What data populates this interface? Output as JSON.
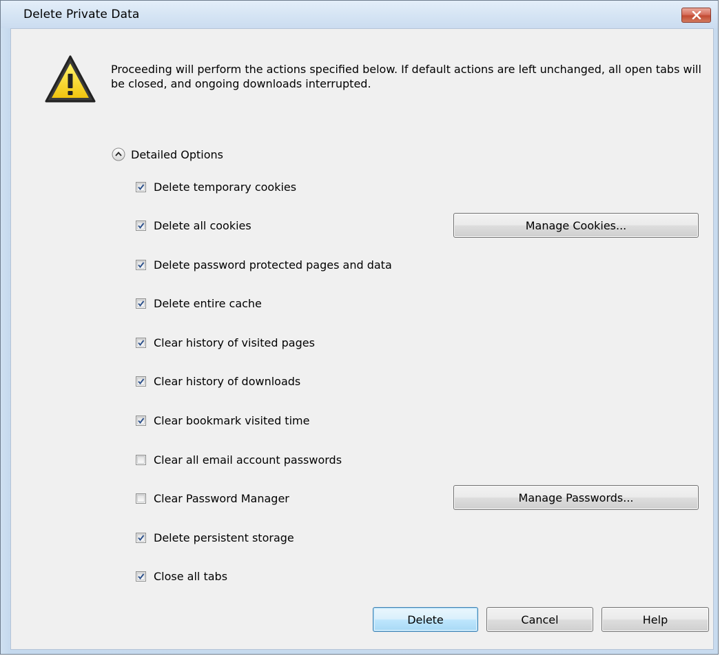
{
  "window": {
    "title": "Delete Private Data"
  },
  "warning": {
    "icon": "warning-icon",
    "message": "Proceeding will perform the actions specified below. If default actions are left unchanged, all open tabs will be closed, and ongoing downloads interrupted."
  },
  "detailed_options": {
    "label": "Detailed Options",
    "expanded": true
  },
  "options": [
    {
      "label": "Delete temporary cookies",
      "checked": true
    },
    {
      "label": "Delete all cookies",
      "checked": true
    },
    {
      "label": "Delete password protected pages and data",
      "checked": true
    },
    {
      "label": "Delete entire cache",
      "checked": true
    },
    {
      "label": "Clear history of visited pages",
      "checked": true
    },
    {
      "label": "Clear history of downloads",
      "checked": true
    },
    {
      "label": "Clear bookmark visited time",
      "checked": true
    },
    {
      "label": "Clear all email account passwords",
      "checked": false
    },
    {
      "label": "Clear Password Manager",
      "checked": false
    },
    {
      "label": "Delete persistent storage",
      "checked": true
    },
    {
      "label": "Close all tabs",
      "checked": true
    }
  ],
  "side_buttons": {
    "manage_cookies": "Manage Cookies...",
    "manage_passwords": "Manage Passwords..."
  },
  "footer": {
    "delete": "Delete",
    "cancel": "Cancel",
    "help": "Help"
  }
}
